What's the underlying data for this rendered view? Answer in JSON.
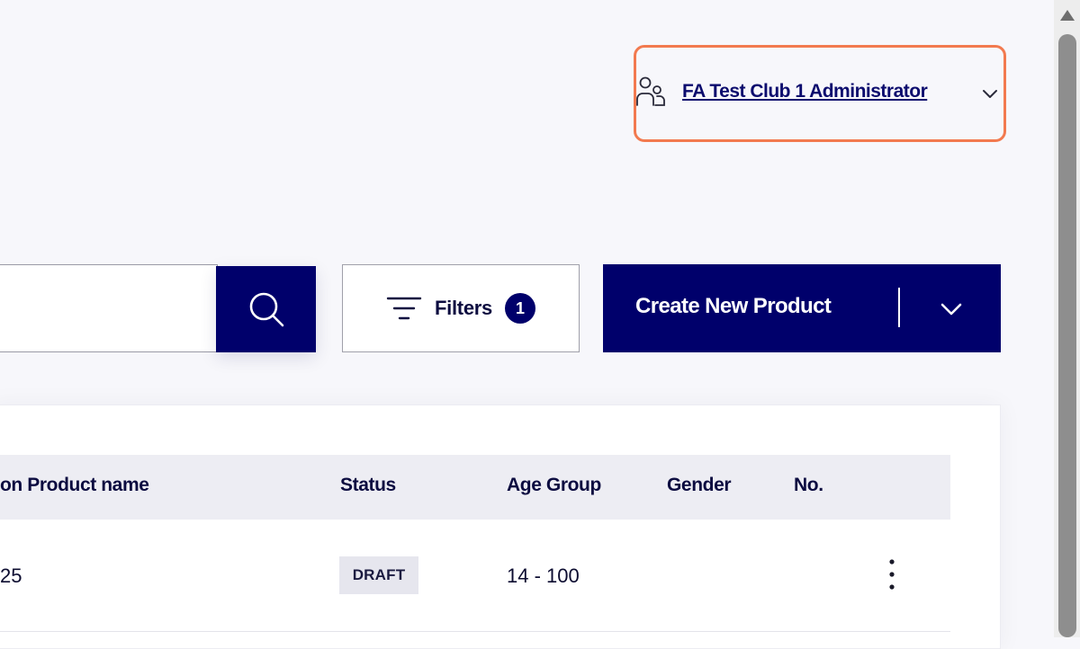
{
  "header": {
    "user_name": "FA Test Club 1 Administrator"
  },
  "toolbar": {
    "search_placeholder": "",
    "search_value": "",
    "filters_label": "Filters",
    "filters_count": "1",
    "create_label": "Create New Product"
  },
  "table": {
    "columns": {
      "product_name": "on Product name",
      "status": "Status",
      "age_group": "Age Group",
      "gender": "Gender",
      "number": "No."
    },
    "rows": [
      {
        "product_name": "25",
        "status": "DRAFT",
        "age_group": "14 - 100",
        "gender": ""
      }
    ]
  },
  "colors": {
    "primary": "#00006b",
    "highlight": "#f27a4f"
  },
  "icons": {
    "user": "users-icon",
    "search": "search-icon",
    "filter": "filter-icon",
    "chevron": "chevron-down-icon",
    "row_menu": "more-vertical-icon"
  }
}
